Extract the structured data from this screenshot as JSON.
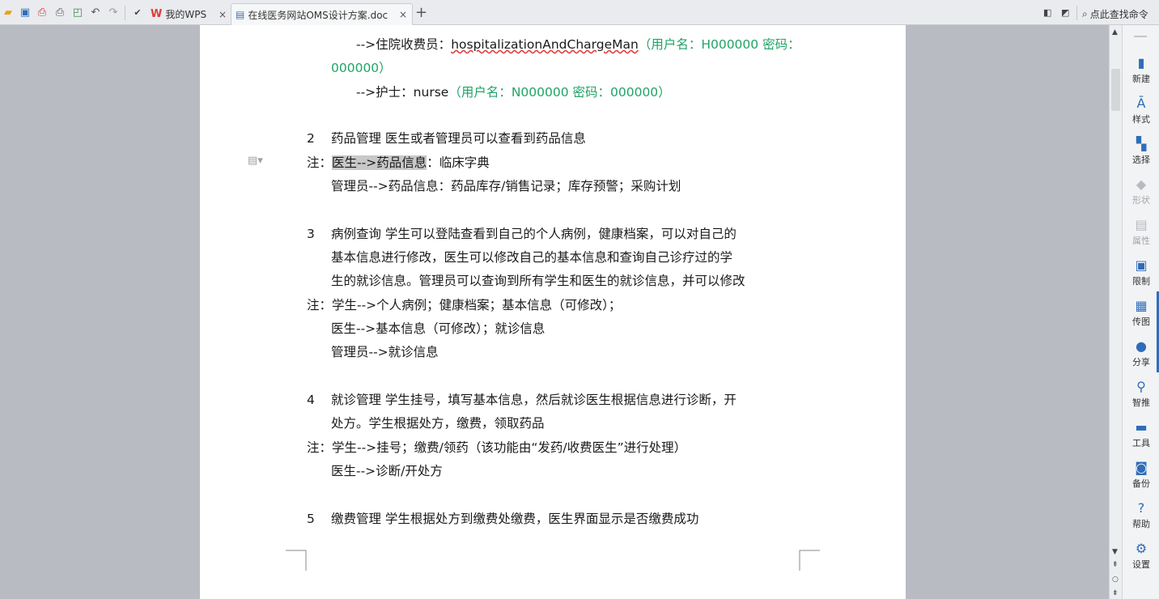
{
  "toolbar": {
    "icons": [
      "open-folder-icon",
      "save-icon",
      "export-pdf-icon",
      "print-icon",
      "print-preview-icon",
      "undo-icon",
      "redo-icon"
    ],
    "tabs": [
      {
        "label": "我的WPS",
        "close": "×"
      },
      {
        "label": "在线医务网站OMS设计方案.doc",
        "close": "×"
      }
    ],
    "new_tab": "+",
    "search_label": "点此查找命令"
  },
  "document": {
    "lines": {
      "l1_prefix": "-->住院收费员：",
      "l1_name": "hospitalizationAndChargeMan",
      "l1_green": "（用户名：H000000 密码：",
      "l2_green": "000000）",
      "l3_prefix": "-->护士：nurse",
      "l3_green": "（用户名：N000000 密码：000000）",
      "s2_num": "2",
      "s2_text": "药品管理   医生或者管理员可以查看到药品信息",
      "s2_note_prefix": "注：",
      "s2_note_hl": "医生-->药品信息",
      "s2_note_rest": "：临床字典",
      "s2_note2": "管理员-->药品信息：药品库存/销售记录；库存预警；采购计划",
      "s3_num": "3",
      "s3_l1": "病例查询   学生可以登陆查看到自己的个人病例，健康档案，可以对自己的",
      "s3_l2": "基本信息进行修改，医生可以修改自己的基本信息和查询自己诊疗过的学",
      "s3_l3": "生的就诊信息。管理员可以查询到所有学生和医生的就诊信息，并可以修改",
      "s3_note1": "注：学生-->个人病例；健康档案；基本信息（可修改）；",
      "s3_note2": "医生-->基本信息（可修改）；就诊信息",
      "s3_note3": "管理员-->就诊信息",
      "s4_num": "4",
      "s4_l1": "就诊管理   学生挂号，填写基本信息，然后就诊医生根据信息进行诊断，开",
      "s4_l2": "处方。学生根据处方，缴费，领取药品",
      "s4_note1": "注：学生-->挂号；缴费/领药（该功能由“发药/收费医生”进行处理）",
      "s4_note2": "医生-->诊断/开处方",
      "s5_num": "5",
      "s5_l1": "缴费管理   学生根据处方到缴费处缴费，医生界面显示是否缴费成功"
    }
  },
  "right_panel": [
    {
      "icon": "new-doc-icon",
      "label": "新建",
      "enabled": true
    },
    {
      "icon": "style-icon",
      "label": "样式",
      "enabled": true
    },
    {
      "icon": "select-icon",
      "label": "选择",
      "enabled": true
    },
    {
      "icon": "shape-icon",
      "label": "形状",
      "enabled": false
    },
    {
      "icon": "properties-icon",
      "label": "属性",
      "enabled": false
    },
    {
      "icon": "restrict-icon",
      "label": "限制",
      "enabled": true
    },
    {
      "icon": "send-image-icon",
      "label": "传图",
      "enabled": true
    },
    {
      "icon": "share-icon",
      "label": "分享",
      "enabled": true
    },
    {
      "icon": "smart-push-icon",
      "label": "智推",
      "enabled": true
    },
    {
      "icon": "tools-icon",
      "label": "工具",
      "enabled": true
    },
    {
      "icon": "backup-icon",
      "label": "备份",
      "enabled": true
    },
    {
      "icon": "help-icon",
      "label": "帮助",
      "enabled": true
    },
    {
      "icon": "settings-icon",
      "label": "设置",
      "enabled": true
    }
  ],
  "colors": {
    "accent": "#2f6db8",
    "green_text": "#21a366",
    "wps_red": "#e03b3b"
  }
}
